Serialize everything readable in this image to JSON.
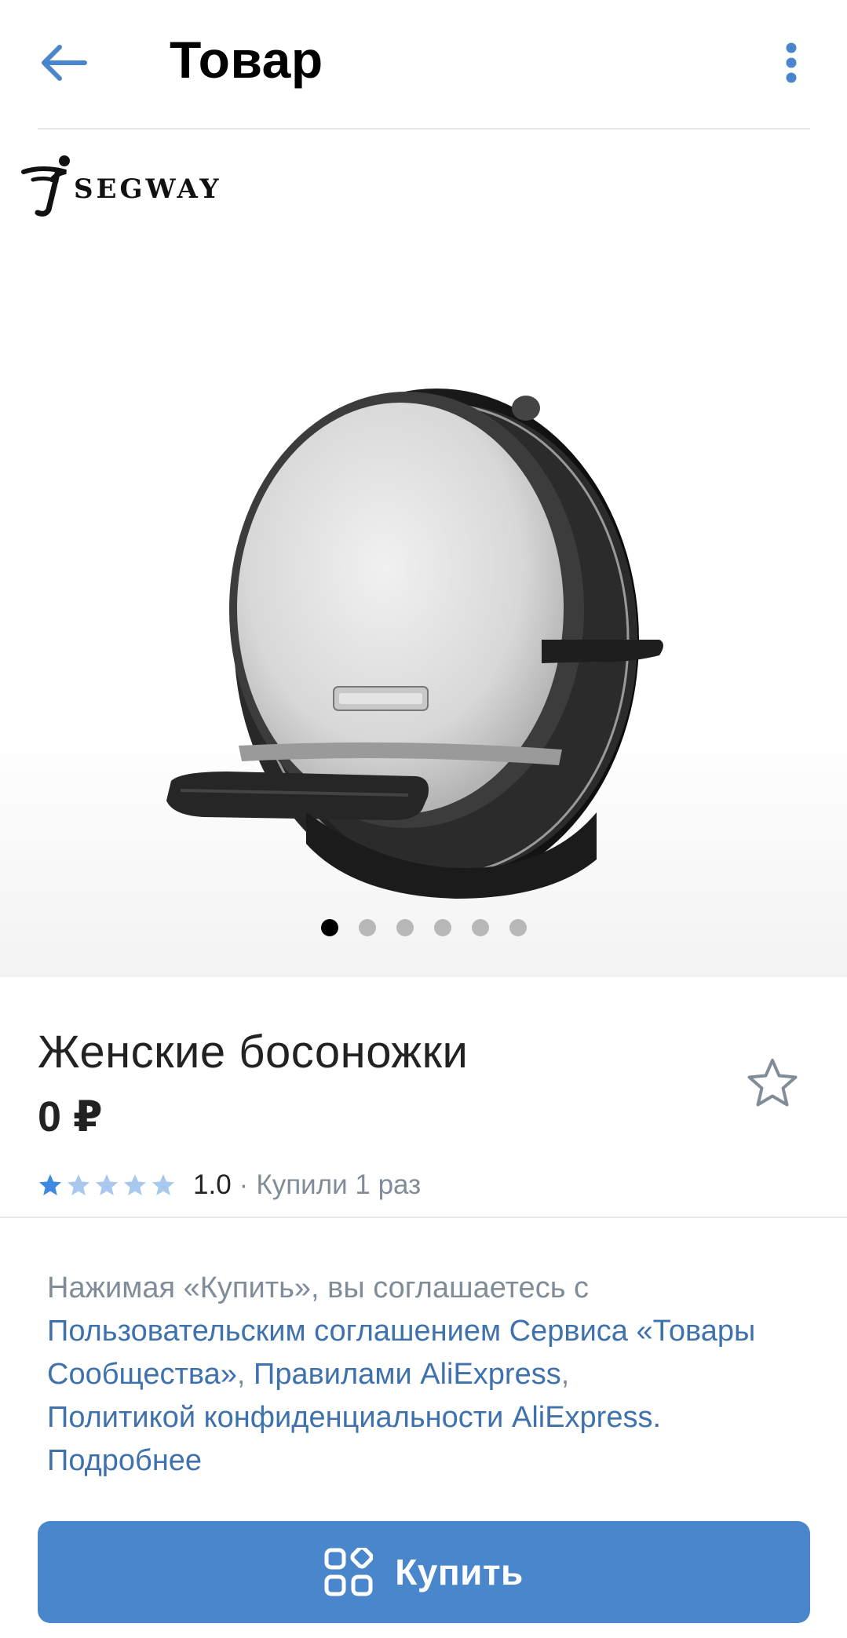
{
  "header": {
    "title": "Товар",
    "back_icon": "arrow-left-icon",
    "more_icon": "more-vertical-icon"
  },
  "gallery": {
    "brand_logo_text": "SEGWAY",
    "image_count": 6,
    "active_index": 0
  },
  "product": {
    "name": "Женские босоножки",
    "price": "0 ₽",
    "rating_value": "1.0",
    "rating_stars": 1,
    "rating_max": 5,
    "separator": "·",
    "bought_text": "Купили 1 раз",
    "favorite_icon": "star-outline-icon"
  },
  "agreement": {
    "prefix": "Нажимая «Купить», вы соглашаетесь с",
    "link_user_agreement": "Пользовательским соглашением Сервиса «Товары Сообщества»",
    "comma1": ",",
    "link_rules": "Правилами AliExpress",
    "comma2": ",",
    "link_privacy": "Политикой конфиденциальности AliExpress",
    "period": ".",
    "link_more": "Подробнее"
  },
  "buy_button": {
    "label": "Купить",
    "icon": "apps-icon"
  },
  "colors": {
    "accent": "#4a86cc",
    "link": "#3f72ad",
    "secondary_text": "#818c99",
    "star_filled": "#3f8ae0",
    "star_empty": "#a8c8ee"
  }
}
